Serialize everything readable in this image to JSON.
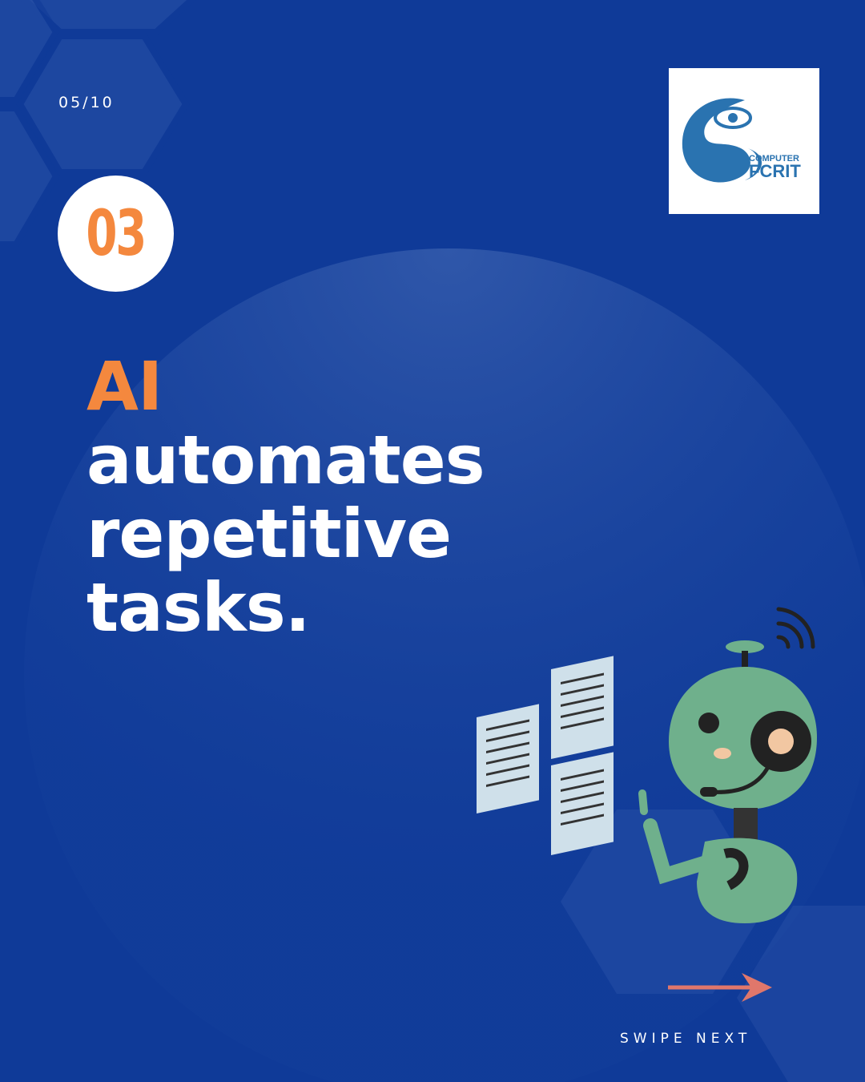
{
  "page_counter": "05/10",
  "logo": {
    "line1": "COMPUTER",
    "line2": "FCRIT"
  },
  "step_number": "03",
  "headline": {
    "accent": "AI",
    "lines": [
      "automates",
      "repetitive",
      "tasks."
    ]
  },
  "swipe_label": "SWIPE NEXT",
  "colors": {
    "background": "#0f3a98",
    "accent": "#f4883e",
    "robot_body": "#6fb08c",
    "arrow": "#e0776b"
  },
  "icons": {
    "robot": "robot-illustration",
    "documents": "document-icon",
    "arrow": "arrow-right-icon"
  }
}
